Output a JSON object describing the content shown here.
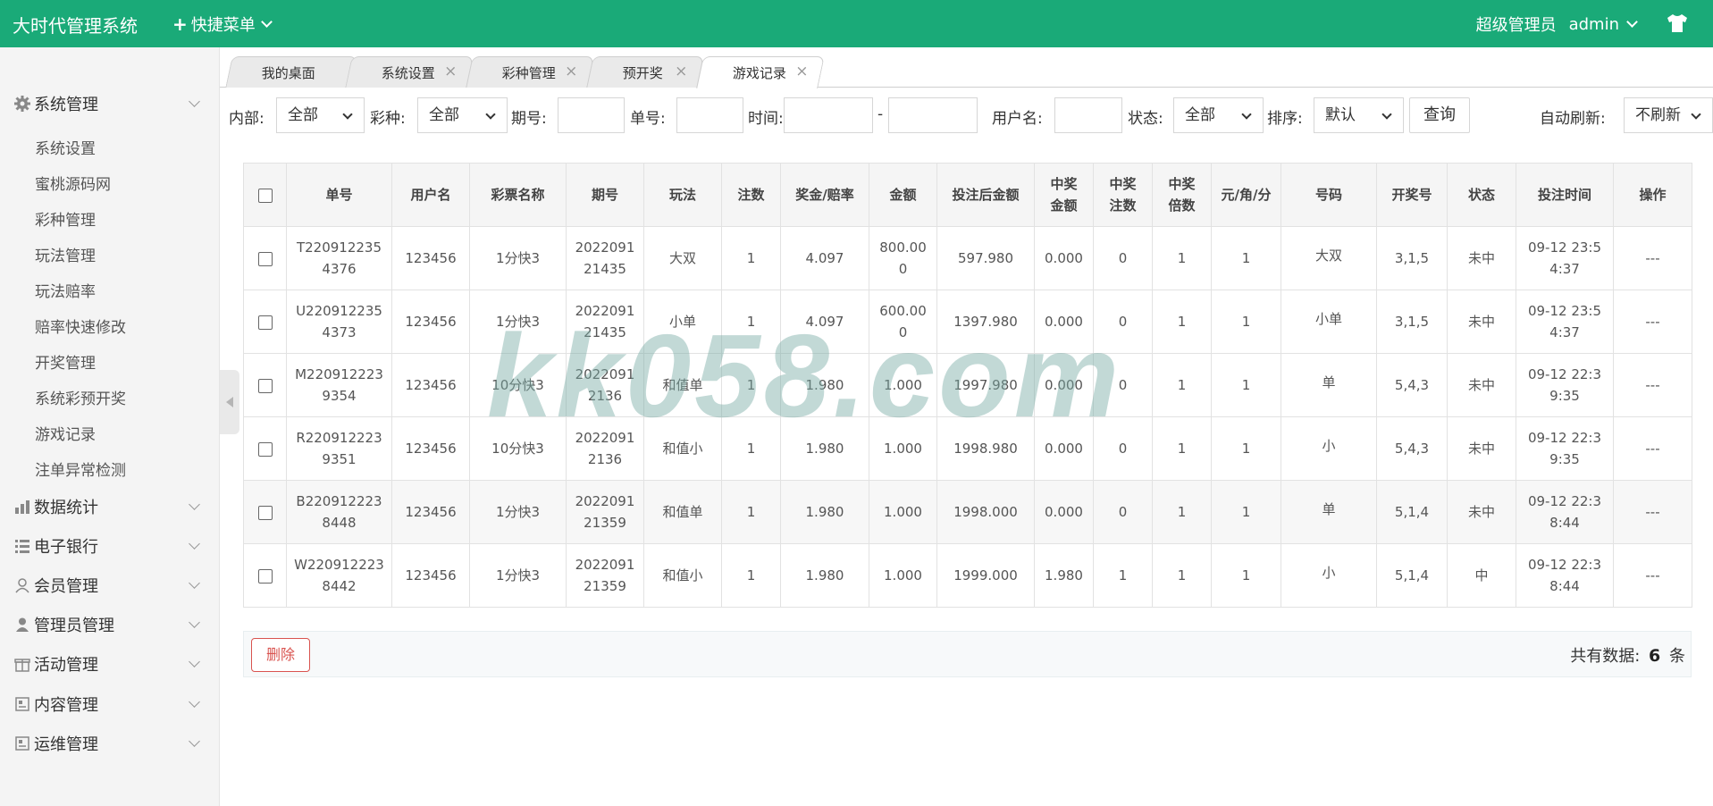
{
  "header": {
    "brand": "大时代管理系统",
    "quick_menu": "快捷菜单",
    "user_role": "超级管理员",
    "user_name": "admin",
    "accent": "#1aaa78"
  },
  "sidebar": {
    "groups": [
      {
        "label": "系统管理",
        "icon": "gear-icon"
      },
      {
        "label": "数据统计",
        "icon": "bar-chart-icon"
      },
      {
        "label": "电子银行",
        "icon": "list-icon"
      },
      {
        "label": "会员管理",
        "icon": "user-outline-icon"
      },
      {
        "label": "管理员管理",
        "icon": "user-icon"
      },
      {
        "label": "活动管理",
        "icon": "gift-icon"
      },
      {
        "label": "内容管理",
        "icon": "document-icon"
      },
      {
        "label": "运维管理",
        "icon": "document-icon"
      }
    ],
    "sub_items": [
      "系统设置",
      "蜜桃源码网",
      "彩种管理",
      "玩法管理",
      "玩法赔率",
      "赔率快速修改",
      "开奖管理",
      "系统彩预开奖",
      "游戏记录",
      "注单异常检测"
    ]
  },
  "tabs": [
    {
      "label": "我的桌面"
    },
    {
      "label": "系统设置"
    },
    {
      "label": "彩种管理"
    },
    {
      "label": "预开奖"
    },
    {
      "label": "游戏记录"
    }
  ],
  "filters": {
    "internal_label": "内部:",
    "internal_value": "全部",
    "lottery_label": "彩种:",
    "lottery_value": "全部",
    "issue_label": "期号:",
    "order_label": "单号:",
    "time_label": "时间:",
    "time_sep": "-",
    "username_label": "用户名:",
    "status_label": "状态:",
    "status_value": "全部",
    "sort_label": "排序:",
    "sort_value": "默认",
    "query_button": "查询",
    "refresh_label": "自动刷新:",
    "refresh_value": "不刷新"
  },
  "table": {
    "headers": [
      "单号",
      "用户名",
      "彩票名称",
      "期号",
      "玩法",
      "注数",
      "奖金/赔率",
      "金额",
      "投注后金额",
      "中奖金额",
      "中奖注数",
      "中奖倍数",
      "元/角/分",
      "号码",
      "开奖号",
      "状态",
      "投注时间",
      "操作"
    ],
    "rows": [
      {
        "order": "T2209122354376",
        "user": "123456",
        "lottery": "1分快3",
        "issue": "2022091 21435",
        "play": "大双",
        "count": "1",
        "odds": "4.097",
        "amount": "800.000",
        "after": "597.980",
        "win_amount": "0.000",
        "win_count": "0",
        "win_mult": "1",
        "unit": "1",
        "numbers": "大双",
        "draw": "3,1,5",
        "status": "未中",
        "time": "09-12 23:54:37",
        "op": "---"
      },
      {
        "order": "U2209122354373",
        "user": "123456",
        "lottery": "1分快3",
        "issue": "2022091 21435",
        "play": "小单",
        "count": "1",
        "odds": "4.097",
        "amount": "600.000",
        "after": "1397.980",
        "win_amount": "0.000",
        "win_count": "0",
        "win_mult": "1",
        "unit": "1",
        "numbers": "小单",
        "draw": "3,1,5",
        "status": "未中",
        "time": "09-12 23:54:37",
        "op": "---"
      },
      {
        "order": "M2209122239354",
        "user": "123456",
        "lottery": "10分快3",
        "issue": "2022091 2136",
        "play": "和值单",
        "count": "1",
        "odds": "1.980",
        "amount": "1.000",
        "after": "1997.980",
        "win_amount": "0.000",
        "win_count": "0",
        "win_mult": "1",
        "unit": "1",
        "numbers": "单",
        "draw": "5,4,3",
        "status": "未中",
        "time": "09-12 22:39:35",
        "op": "---"
      },
      {
        "order": "R2209122239351",
        "user": "123456",
        "lottery": "10分快3",
        "issue": "2022091 2136",
        "play": "和值小",
        "count": "1",
        "odds": "1.980",
        "amount": "1.000",
        "after": "1998.980",
        "win_amount": "0.000",
        "win_count": "0",
        "win_mult": "1",
        "unit": "1",
        "numbers": "小",
        "draw": "5,4,3",
        "status": "未中",
        "time": "09-12 22:39:35",
        "op": "---"
      },
      {
        "order": "B2209122238448",
        "user": "123456",
        "lottery": "1分快3",
        "issue": "2022091 21359",
        "play": "和值单",
        "count": "1",
        "odds": "1.980",
        "amount": "1.000",
        "after": "1998.000",
        "win_amount": "0.000",
        "win_count": "0",
        "win_mult": "1",
        "unit": "1",
        "numbers": "单",
        "draw": "5,1,4",
        "status": "未中",
        "time": "09-12 22:38:44",
        "op": "---"
      },
      {
        "order": "W2209122238442",
        "user": "123456",
        "lottery": "1分快3",
        "issue": "2022091 21359",
        "play": "和值小",
        "count": "1",
        "odds": "1.980",
        "amount": "1.000",
        "after": "1999.000",
        "win_amount": "1.980",
        "win_count": "1",
        "win_mult": "1",
        "unit": "1",
        "numbers": "小",
        "draw": "5,1,4",
        "status": "中",
        "time": "09-12 22:38:44",
        "op": "---"
      }
    ]
  },
  "footer": {
    "delete_button": "删除",
    "total_prefix": "共有数据:",
    "total_count": "6",
    "total_suffix": "条"
  },
  "watermark": "kk058.com",
  "colors": {
    "lose": "#e02020",
    "win": "#1a9a40",
    "delete": "#d9534f"
  }
}
